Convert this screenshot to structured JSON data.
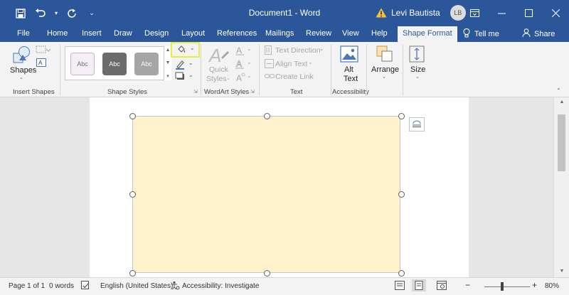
{
  "window": {
    "doc_title": "Document1 - Word",
    "user_name": "Levi Bautista",
    "user_initials": "LB"
  },
  "tabs": [
    {
      "label": "File"
    },
    {
      "label": "Home"
    },
    {
      "label": "Insert"
    },
    {
      "label": "Draw"
    },
    {
      "label": "Design"
    },
    {
      "label": "Layout"
    },
    {
      "label": "References"
    },
    {
      "label": "Mailings"
    },
    {
      "label": "Review"
    },
    {
      "label": "View"
    },
    {
      "label": "Help"
    },
    {
      "label": "Shape Format"
    }
  ],
  "tell_me": "Tell me",
  "share": "Share",
  "ribbon": {
    "insert_shapes": {
      "shapes_label": "Shapes",
      "group_label": "Insert Shapes"
    },
    "shape_styles": {
      "swatch_text": "Abc",
      "group_label": "Shape Styles"
    },
    "wordart_styles": {
      "quick_styles_line1": "Quick",
      "quick_styles_line2": "Styles",
      "group_label": "WordArt Styles"
    },
    "text": {
      "text_direction": "Text Direction",
      "align_text": "Align Text",
      "create_link": "Create Link",
      "group_label": "Text"
    },
    "accessibility": {
      "alt_text_line1": "Alt",
      "alt_text_line2": "Text",
      "group_label": "Accessibility"
    },
    "arrange": {
      "label": "Arrange"
    },
    "size": {
      "label": "Size"
    }
  },
  "status": {
    "page": "Page 1 of 1",
    "words": "0 words",
    "language": "English (United States)",
    "accessibility": "Accessibility: Investigate",
    "zoom": "80%",
    "zoom_level": 0.8
  },
  "colors": {
    "title_bar": "#2b579a",
    "shape_fill": "#fff2cc",
    "highlight": "#e7ee3c",
    "swatch_1": "#f4eef5",
    "swatch_2": "#6b6b6b",
    "swatch_3": "#a5a5a5"
  }
}
